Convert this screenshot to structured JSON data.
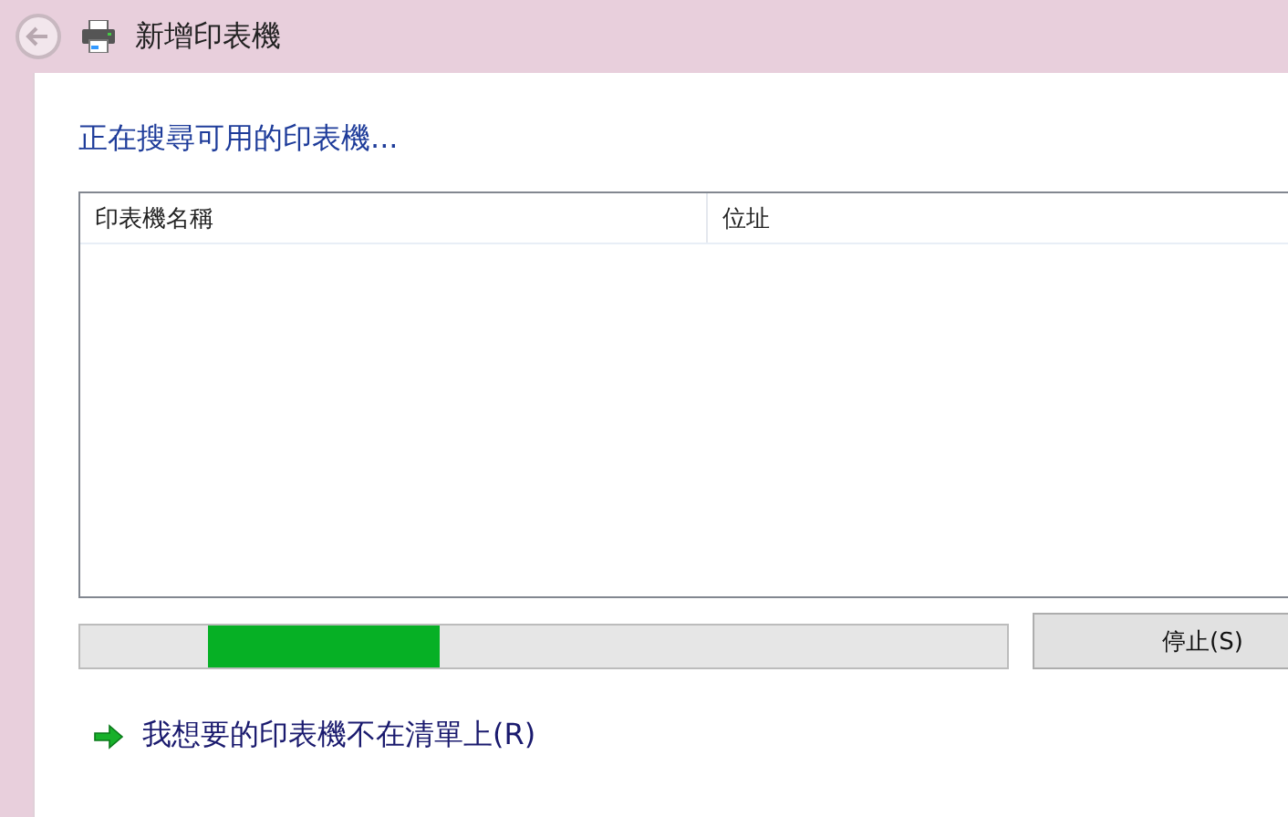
{
  "window": {
    "title": "新增印表機"
  },
  "heading": "正在搜尋可用的印表機...",
  "table": {
    "columns": [
      "印表機名稱",
      "位址"
    ]
  },
  "progress": {
    "level": 0.25
  },
  "stop_button": "停止(S)",
  "link": "我想要的印表機不在清單上(R)"
}
